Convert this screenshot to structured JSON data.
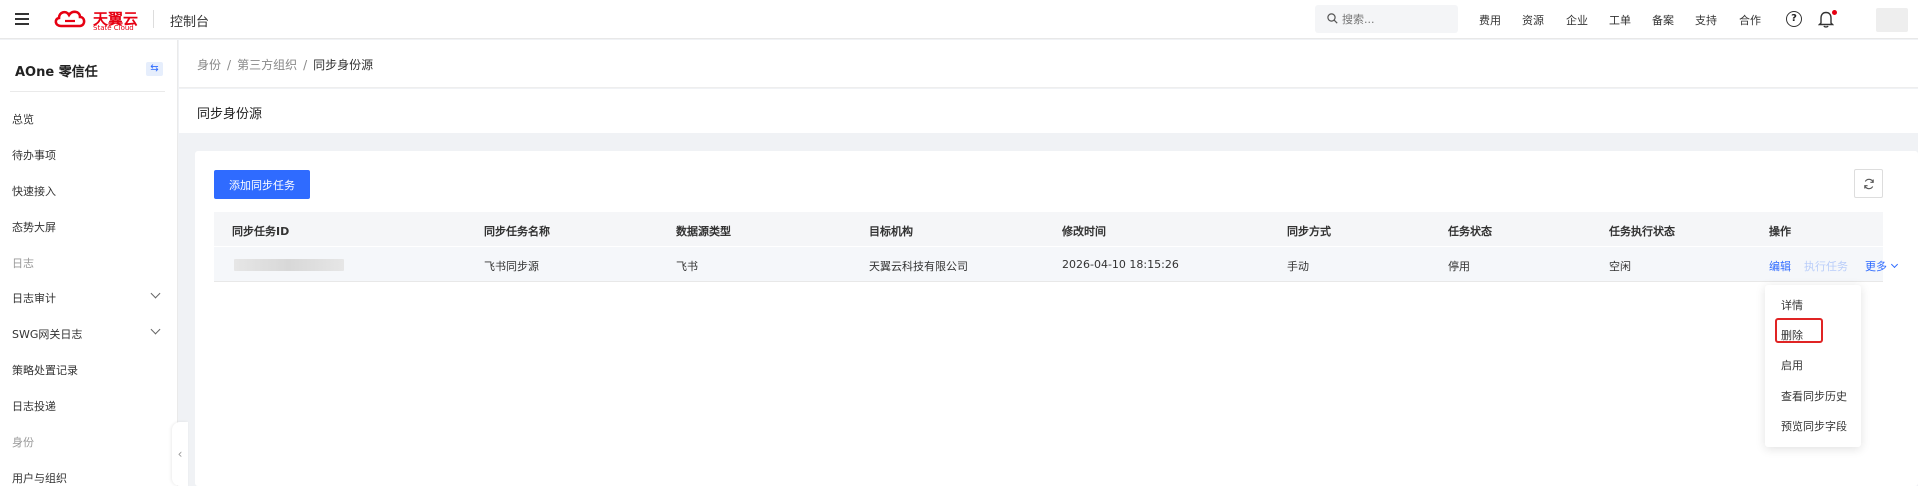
{
  "topbar": {
    "brand_cn": "天翼云",
    "brand_en": "State Cloud",
    "console_title": "控制台",
    "search_placeholder": "搜索...",
    "nav": [
      "费用",
      "资源",
      "企业",
      "工单",
      "备案",
      "支持",
      "合作"
    ],
    "help_glyph": "?"
  },
  "sidebar": {
    "title": "AOne 零信任",
    "items": [
      {
        "label": "总览",
        "type": "item"
      },
      {
        "label": "待办事项",
        "type": "item"
      },
      {
        "label": "快速接入",
        "type": "item"
      },
      {
        "label": "态势大屏",
        "type": "item"
      },
      {
        "label": "日志",
        "type": "group"
      },
      {
        "label": "日志审计",
        "type": "item",
        "expandable": true
      },
      {
        "label": "SWG网关日志",
        "type": "item",
        "expandable": true
      },
      {
        "label": "策略处置记录",
        "type": "item"
      },
      {
        "label": "日志投递",
        "type": "item"
      },
      {
        "label": "身份",
        "type": "group"
      },
      {
        "label": "用户与组织",
        "type": "item"
      }
    ]
  },
  "breadcrumb": {
    "items": [
      "身份",
      "第三方组织",
      "同步身份源"
    ],
    "separator": "/"
  },
  "page": {
    "title": "同步身份源"
  },
  "toolbar": {
    "add_label": "添加同步任务"
  },
  "table": {
    "columns": [
      "同步任务ID",
      "同步任务名称",
      "数据源类型",
      "目标机构",
      "修改时间",
      "同步方式",
      "任务状态",
      "任务执行状态",
      "操作"
    ],
    "rows": [
      {
        "id": "",
        "name": "飞书同步源",
        "source_type": "飞书",
        "target_org": "天翼云科技有限公司",
        "modified": "2026-04-10 18:15:26",
        "sync_mode": "手动",
        "task_status": "停用",
        "exec_status": "空闲",
        "actions": {
          "edit": "编辑",
          "run": "执行任务",
          "more": "更多"
        }
      }
    ]
  },
  "more_menu": {
    "items": [
      "详情",
      "删除",
      "启用",
      "查看同步历史",
      "预览同步字段"
    ],
    "highlighted": "删除"
  },
  "colors": {
    "primary": "#2f6bff",
    "brand_red": "#e60012",
    "highlight_box": "#e02424"
  }
}
